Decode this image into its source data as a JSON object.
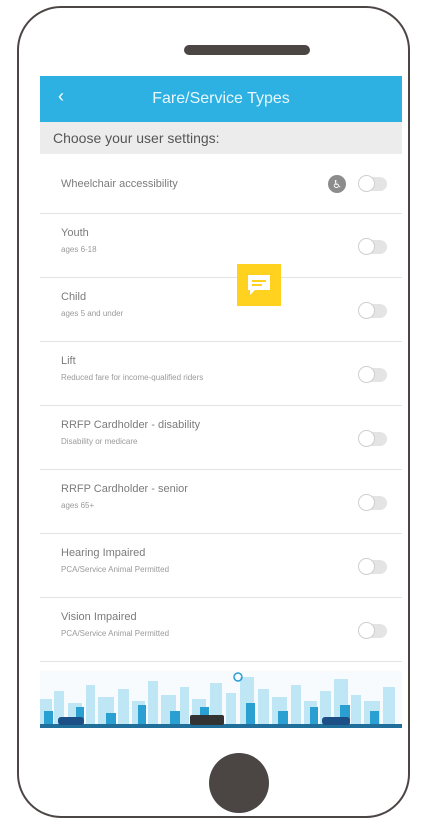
{
  "header": {
    "title": "Fare/Service Types",
    "back_icon": "chevron-left-icon"
  },
  "section": {
    "heading": "Choose your user settings:"
  },
  "options": [
    {
      "title": "Wheelchair accessibility",
      "subtitle": "",
      "enabled": false
    },
    {
      "title": "Youth",
      "subtitle": "ages 6-18",
      "enabled": false
    },
    {
      "title": "Child",
      "subtitle": "ages 5 and under",
      "enabled": false
    },
    {
      "title": "Lift",
      "subtitle": "Reduced fare for income-qualified riders",
      "enabled": false
    },
    {
      "title": "RRFP Cardholder - disability",
      "subtitle": "Disability or medicare",
      "enabled": false
    },
    {
      "title": "RRFP Cardholder - senior",
      "subtitle": "ages 65+",
      "enabled": false
    },
    {
      "title": "Hearing Impaired",
      "subtitle": "PCA/Service Animal Permitted",
      "enabled": false
    },
    {
      "title": "Vision Impaired",
      "subtitle": "PCA/Service Animal Permitted",
      "enabled": false
    }
  ],
  "colors": {
    "header": "#2cb1e2",
    "chat": "#ffd21f",
    "frame": "#4b4544"
  }
}
